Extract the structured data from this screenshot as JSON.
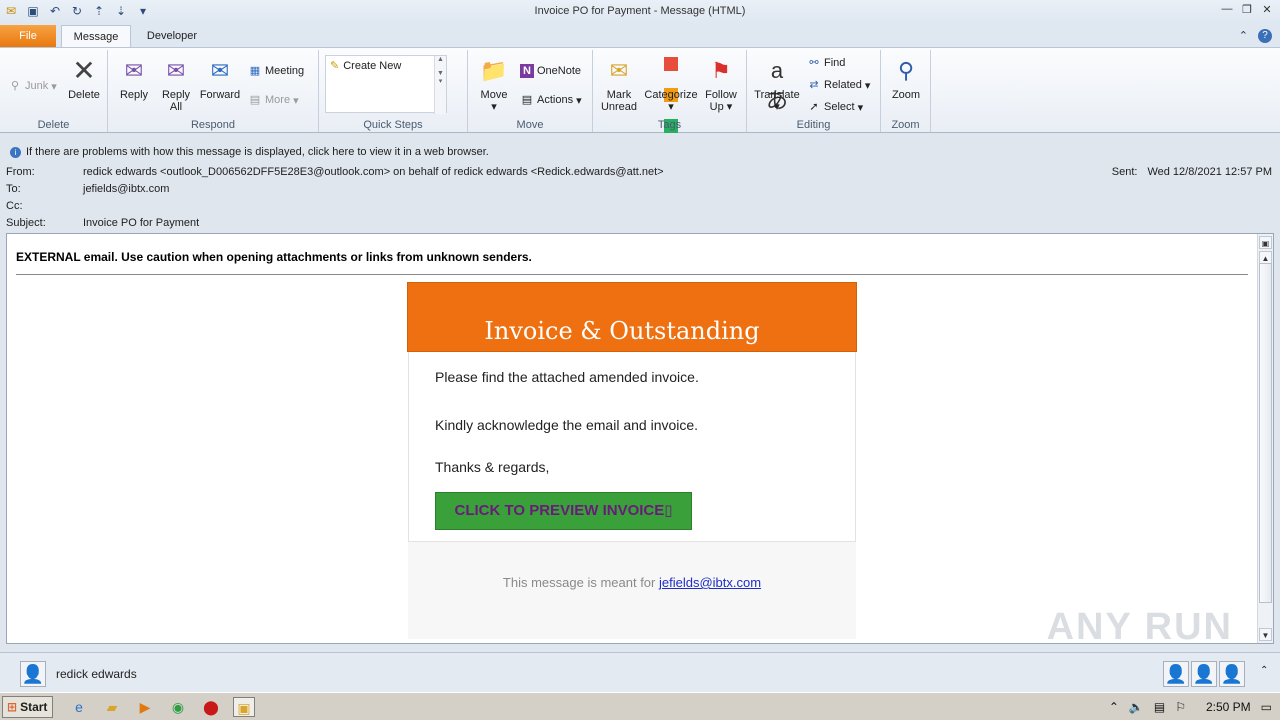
{
  "window": {
    "title": "Invoice PO for Payment -  Message (HTML)",
    "qat_icons": [
      "outlook-icon",
      "save-icon",
      "undo-icon",
      "redo-icon",
      "up-icon",
      "down-icon",
      "customize-icon"
    ]
  },
  "tabs": {
    "file": "File",
    "message": "Message",
    "developer": "Developer"
  },
  "ribbon": {
    "delete_group": {
      "label": "Delete",
      "junk": "Junk",
      "delete": "Delete"
    },
    "respond_group": {
      "label": "Respond",
      "reply": "Reply",
      "reply_all_1": "Reply",
      "reply_all_2": "All",
      "forward": "Forward",
      "meeting": "Meeting",
      "more": "More"
    },
    "quick_steps_group": {
      "label": "Quick Steps",
      "create_new": "Create New"
    },
    "move_group": {
      "label": "Move",
      "move": "Move",
      "onenote": "OneNote",
      "actions": "Actions"
    },
    "tags_group": {
      "label": "Tags",
      "mark_unread_1": "Mark",
      "mark_unread_2": "Unread",
      "categorize": "Categorize",
      "follow_up_1": "Follow",
      "follow_up_2": "Up"
    },
    "editing_group": {
      "label": "Editing",
      "translate": "Translate",
      "find": "Find",
      "related": "Related",
      "select": "Select"
    },
    "zoom_group": {
      "label": "Zoom",
      "zoom": "Zoom"
    }
  },
  "header": {
    "info": "If there are problems with how this message is displayed, click here to view it in a web browser.",
    "from_label": "From:",
    "from_value": "redick edwards <outlook_D006562DFF5E28E3@outlook.com> on behalf of redick edwards <Redick.edwards@att.net>",
    "to_label": "To:",
    "to_value": "jefields@ibtx.com",
    "cc_label": "Cc:",
    "cc_value": "",
    "subject_label": "Subject:",
    "subject_value": "Invoice PO for Payment",
    "sent_label": "Sent:",
    "sent_value": "Wed 12/8/2021 12:57 PM"
  },
  "message": {
    "warning": "EXTERNAL email. Use caution when opening attachments or links from unknown senders.",
    "banner_title": "Invoice & Outstanding",
    "line1": "Please find the attached amended invoice.",
    "line2": "Kindly acknowledge the email and invoice.",
    "line3": "Thanks & regards,",
    "cta": "CLICK TO PREVIEW INVOICE▯",
    "footer_prefix": "This message is meant for ",
    "footer_link": "jefields@ibtx.com",
    "banner_color": "#ef7010",
    "cta_color": "#3aa13a"
  },
  "watermark": "ANY RUN",
  "people_pane": {
    "name": "redick edwards"
  },
  "taskbar": {
    "start": "Start",
    "clock": "2:50 PM",
    "icons": [
      "ie-icon",
      "explorer-icon",
      "media-icon",
      "chrome-icon",
      "opera-icon",
      "outlook-icon"
    ]
  }
}
